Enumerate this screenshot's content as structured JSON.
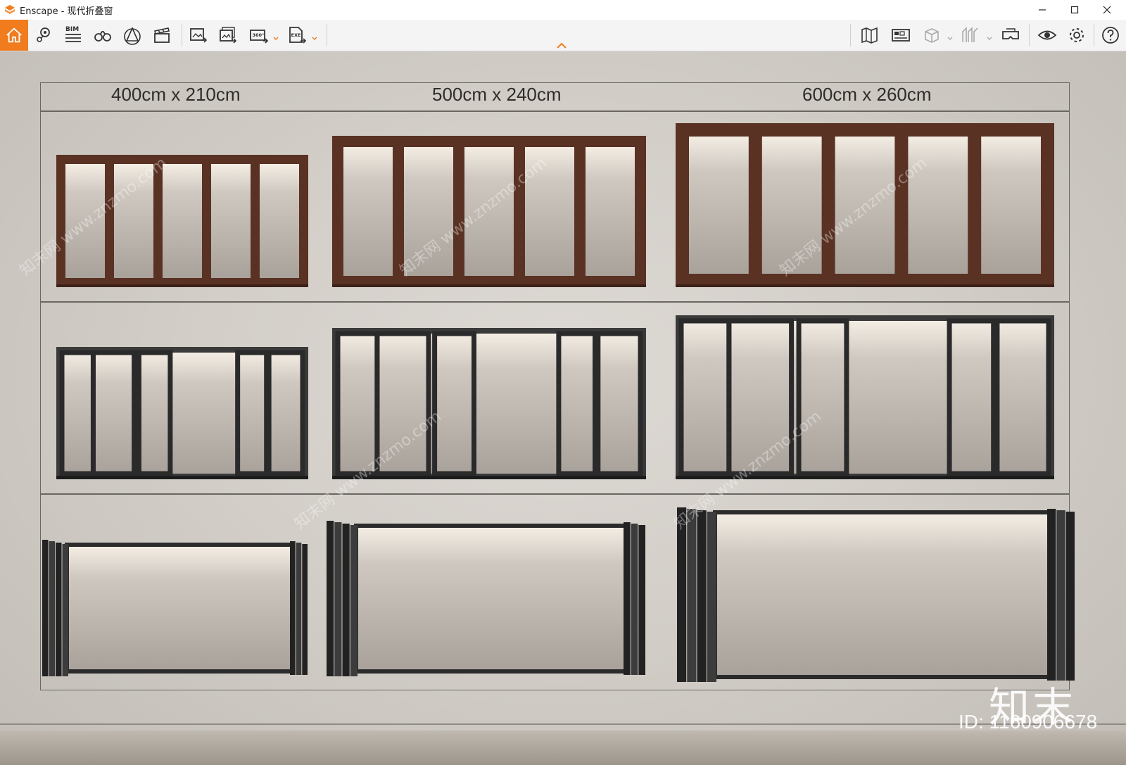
{
  "window": {
    "title": "Enscape - 现代折叠窗",
    "controls": {
      "minimize": "minimize-icon",
      "maximize": "maximize-icon",
      "close": "close-icon"
    }
  },
  "toolbar": {
    "accent_color": "#f07c1e",
    "left_tools": [
      "home-icon",
      "location-pin-icon",
      "bim-list-icon",
      "binoculars-icon",
      "view-cone-icon",
      "clapperboard-icon",
      "screenshot-export-icon",
      "batch-render-icon",
      "panorama-360-icon",
      "exe-export-icon"
    ],
    "bim_label": "BIM",
    "pano_label": "360°",
    "exe_label": "EXE",
    "right_tools": [
      "map-icon",
      "asset-library-icon",
      "cube-view-icon",
      "section-icon",
      "vr-headset-icon",
      "visual-settings-eye-icon",
      "settings-gear-icon",
      "help-icon"
    ]
  },
  "viewport": {
    "column_labels": [
      "400cm x 210cm",
      "500cm x 240cm",
      "600cm x 260cm"
    ],
    "rows": [
      {
        "style": "brown aluminum frame, closed",
        "frame_color": "#5a3224"
      },
      {
        "style": "black frame, partially folded",
        "frame_color": "#2a2a2a"
      },
      {
        "style": "black frame, fully folded open",
        "frame_color": "#2a2a2a"
      }
    ],
    "watermark": "知末网 www.znzmo.com",
    "brand_mark": "知末",
    "image_id": "ID: 1160906678"
  }
}
